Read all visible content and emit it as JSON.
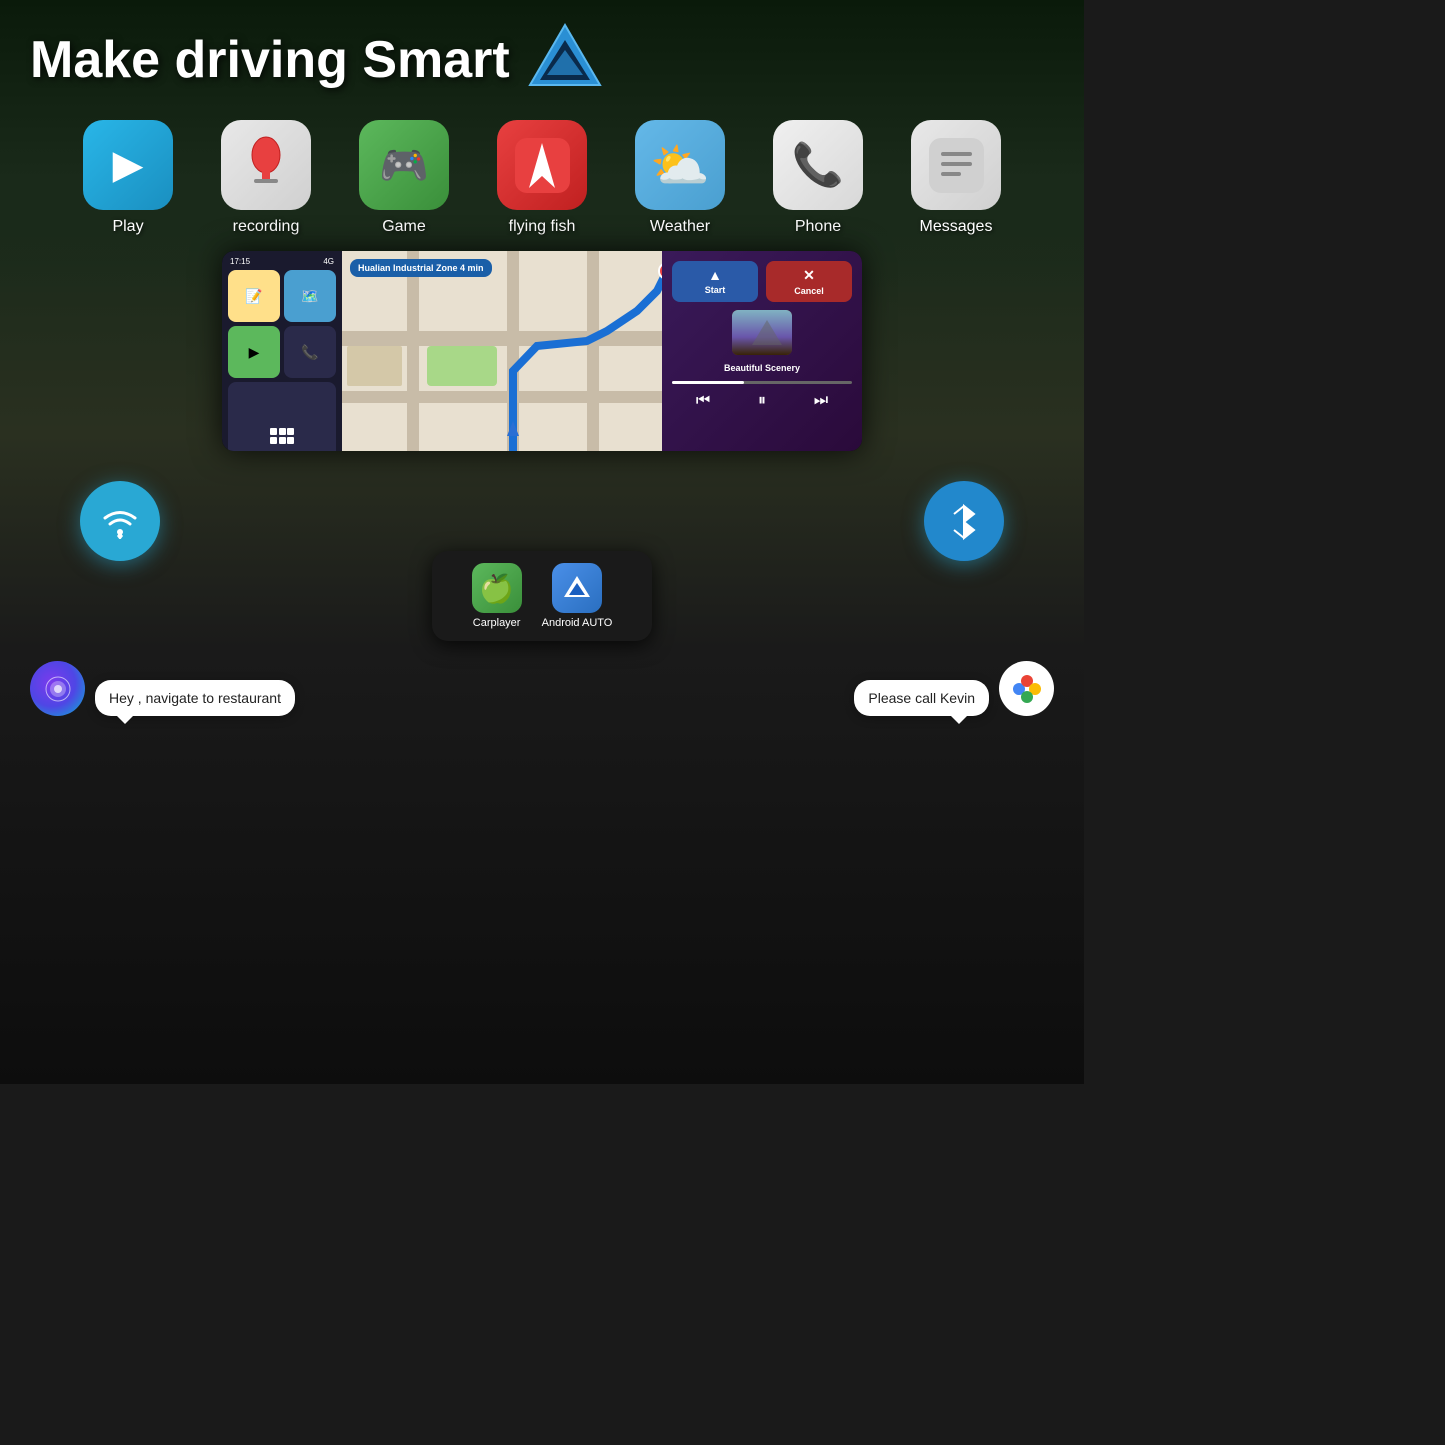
{
  "header": {
    "title": "Make driving Smart",
    "logo": "V-logo"
  },
  "apps": [
    {
      "id": "play",
      "label": "Play",
      "icon": "▶",
      "bg_class": "icon-play"
    },
    {
      "id": "recording",
      "label": "recording",
      "icon": "🎤",
      "bg_class": "icon-recording"
    },
    {
      "id": "game",
      "label": "Game",
      "icon": "🎮",
      "bg_class": "icon-game"
    },
    {
      "id": "flying-fish",
      "label": "flying fish",
      "icon": "⚡",
      "bg_class": "icon-flash"
    },
    {
      "id": "weather",
      "label": "Weather",
      "icon": "⛅",
      "bg_class": "icon-weather"
    },
    {
      "id": "phone",
      "label": "Phone",
      "icon": "📞",
      "bg_class": "icon-phone"
    },
    {
      "id": "messages",
      "label": "Messages",
      "icon": "💬",
      "bg_class": "icon-messages"
    }
  ],
  "display": {
    "time": "17:15",
    "signal": "4G",
    "nav_banner": "Hualian Industrial Zone 4 min",
    "music_title": "Beautiful Scenery",
    "start_label": "Start",
    "cancel_label": "Cancel"
  },
  "connectivity": {
    "wifi_icon": "wifi-icon",
    "bluetooth_icon": "bluetooth-icon"
  },
  "phone_apps": [
    {
      "id": "carplayer",
      "label": "Carplayer",
      "icon": "🍏",
      "bg_class": "icon-carplay"
    },
    {
      "id": "android-auto",
      "label": "Android AUTO",
      "icon": "▲",
      "bg_class": "icon-android"
    }
  ],
  "voice": {
    "siri_text": "Hey , navigate to restaurant",
    "google_text": "Please call Kevin"
  }
}
